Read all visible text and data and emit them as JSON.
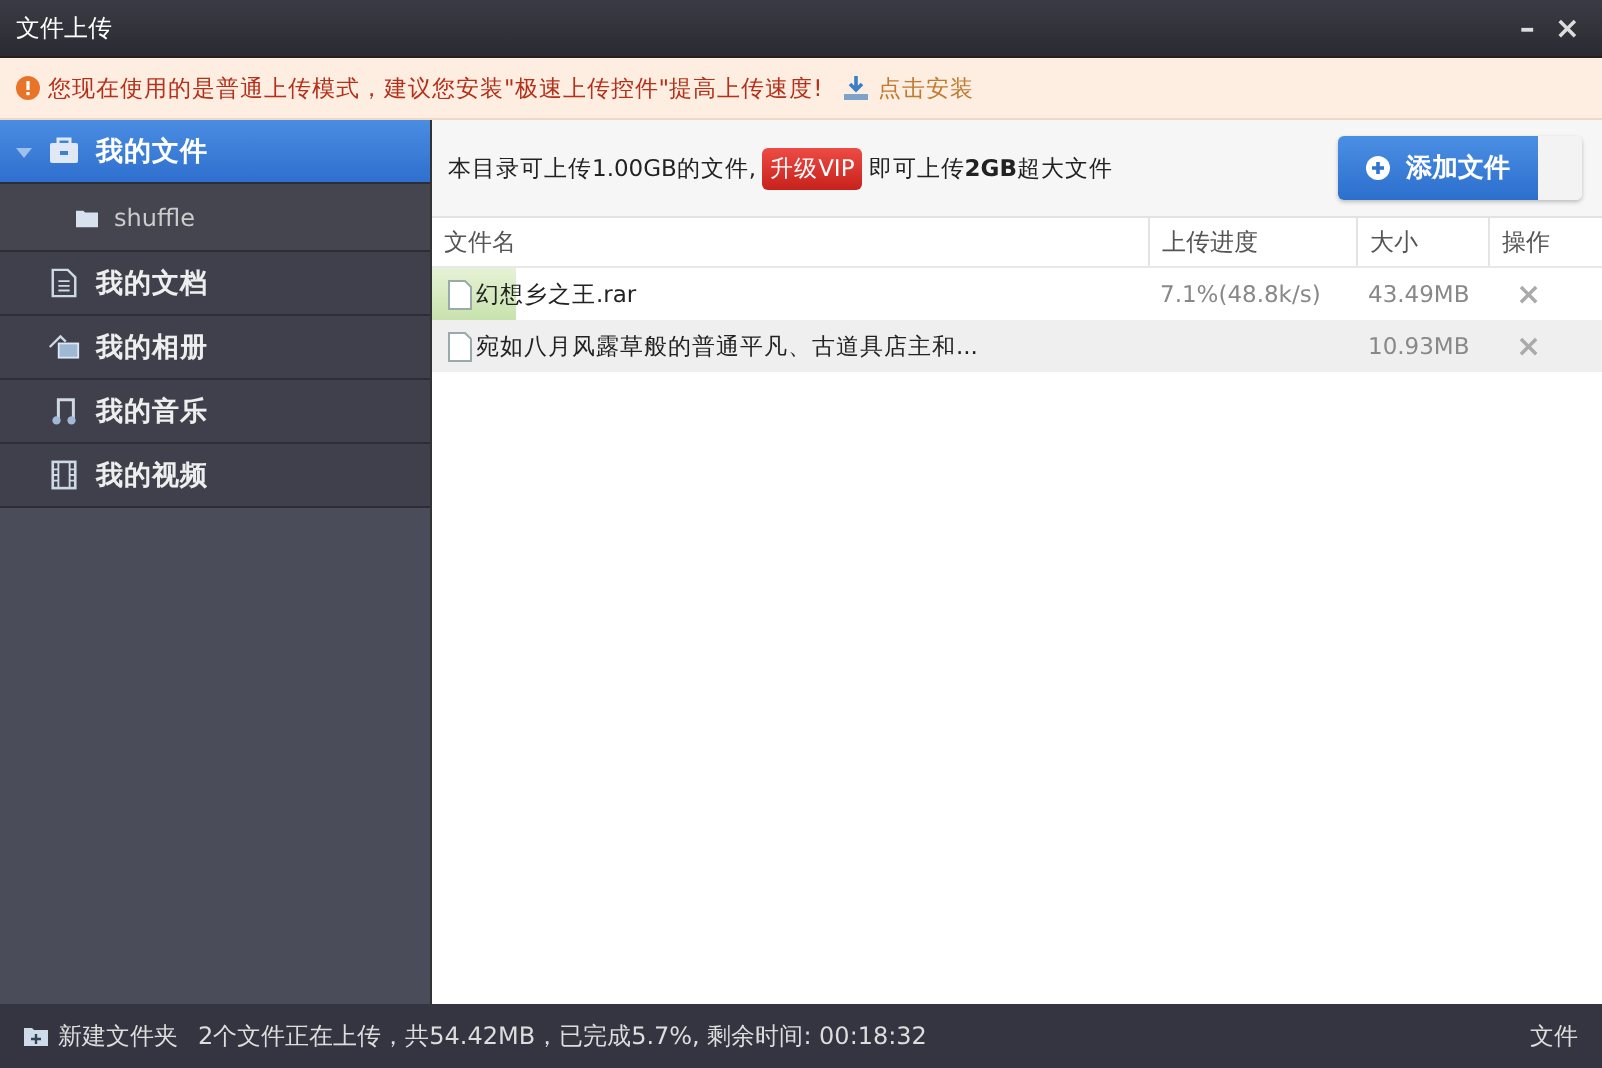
{
  "window": {
    "title": "文件上传",
    "controls": [
      "–",
      "×"
    ]
  },
  "notice": {
    "text": "您现在使用的是普通上传模式，建议您安装\"极速上传控件\"提高上传速度!",
    "link": "点击安装"
  },
  "sidebar": {
    "items": [
      {
        "label": "我的文件",
        "selected": true,
        "expanded": true,
        "children": [
          {
            "label": "shuffle",
            "selected": false
          }
        ]
      },
      {
        "label": "我的文档",
        "selected": false
      },
      {
        "label": "我的相册",
        "selected": false
      },
      {
        "label": "我的音乐",
        "selected": false
      },
      {
        "label": "我的视频",
        "selected": false
      }
    ]
  },
  "quota": {
    "before": "本目录可上传1.00GB的文件,",
    "vip_button": "升级VIP",
    "after": "即可上传**2GB**超大文件"
  },
  "add_button": "添加文件",
  "table": {
    "columns": [
      "文件名",
      "上传进度",
      "大小",
      "操作"
    ],
    "rows": [
      {
        "name": "幻想乡之王.rar",
        "progress": "7.1%(48.8k/s)",
        "level": 0.071,
        "size": "43.49MB",
        "action": "×"
      },
      {
        "name": "宛如八月风露草般的普通平凡、古道具店主和...",
        "size": "10.93MB",
        "action": "×"
      }
    ]
  },
  "status_bar": {
    "new_folder": "新建文件夹",
    "summary": "2个文件正在上传，共54.42MB，已完成5.7%, 剩余时间: 00:18:32",
    "right_text": "文件"
  }
}
